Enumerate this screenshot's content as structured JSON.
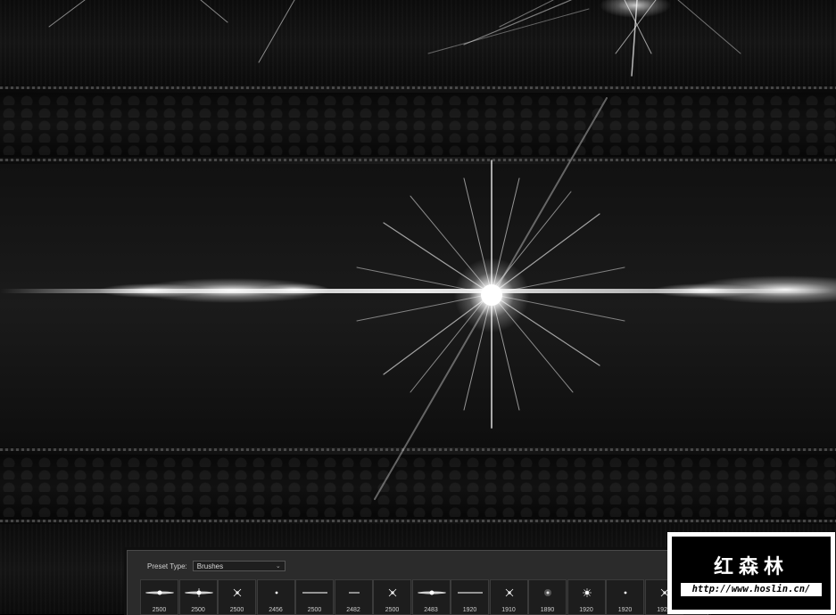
{
  "colors": {
    "background": "#000000",
    "panel": "#2b2b2b",
    "flare": "#ffffff",
    "watermark_frame": "#ffffff"
  },
  "panel": {
    "preset_type_label": "Preset Type:",
    "preset_type_value": "Brushes",
    "dropdown_icon": "chevron-down-icon",
    "settings_icon": "gear-icon",
    "brushes": [
      {
        "size": "2500",
        "shape": "streak"
      },
      {
        "size": "2500",
        "shape": "star-streak"
      },
      {
        "size": "2500",
        "shape": "x-star"
      },
      {
        "size": "2456",
        "shape": "dot"
      },
      {
        "size": "2500",
        "shape": "line"
      },
      {
        "size": "2482",
        "shape": "short-line"
      },
      {
        "size": "2500",
        "shape": "small-star"
      },
      {
        "size": "2483",
        "shape": "glow-streak"
      },
      {
        "size": "1920",
        "shape": "line"
      },
      {
        "size": "1910",
        "shape": "spark"
      },
      {
        "size": "1890",
        "shape": "soft-dot"
      },
      {
        "size": "1920",
        "shape": "burst"
      },
      {
        "size": "1920",
        "shape": "dot"
      },
      {
        "size": "1920",
        "shape": "small-star"
      }
    ]
  },
  "watermark": {
    "title": "红森林",
    "url": "http://www.hoslin.cn/"
  }
}
